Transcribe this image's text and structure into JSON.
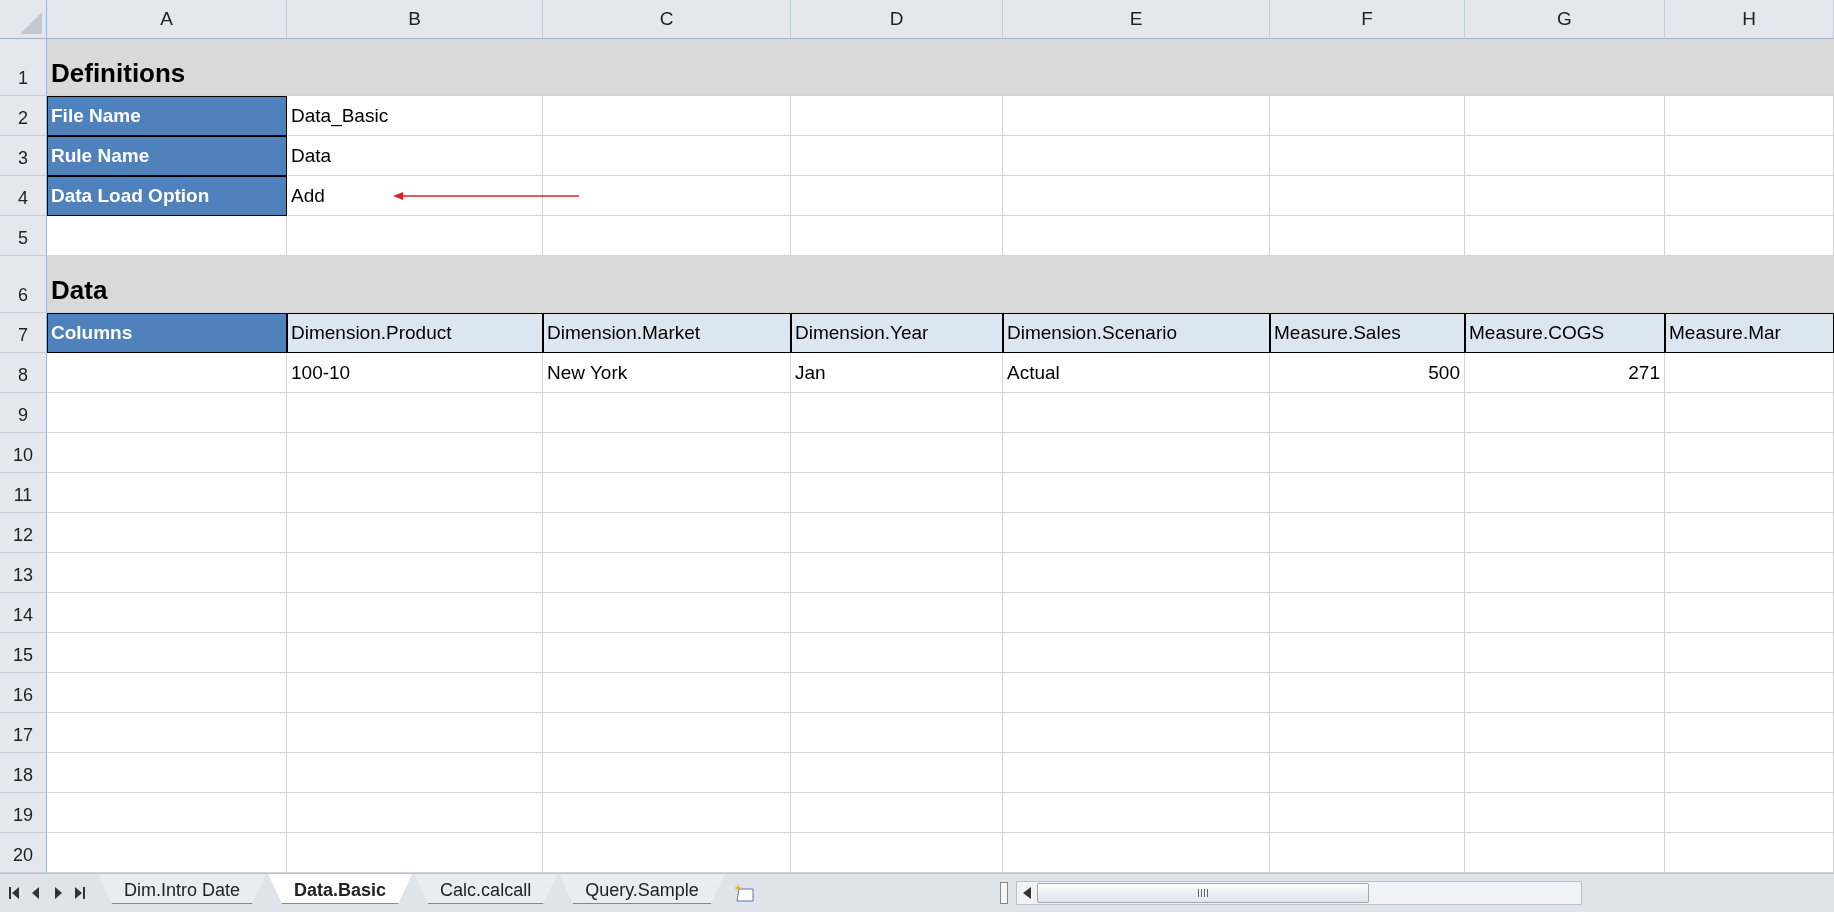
{
  "column_headers": [
    "A",
    "B",
    "C",
    "D",
    "E",
    "F",
    "G",
    "H"
  ],
  "rows": [
    {
      "number": "1",
      "kind": "title",
      "text": "Definitions"
    },
    {
      "number": "2",
      "kind": "field",
      "label": "File Name",
      "value": "Data_Basic",
      "arrow": false
    },
    {
      "number": "3",
      "kind": "field",
      "label": "Rule Name",
      "value": "Data",
      "arrow": false
    },
    {
      "number": "4",
      "kind": "field",
      "label": "Data Load Option",
      "value": "Add",
      "arrow": true
    },
    {
      "number": "5",
      "kind": "blank"
    },
    {
      "number": "6",
      "kind": "title",
      "text": "Data"
    },
    {
      "number": "7",
      "kind": "columns",
      "label": "Columns",
      "headers": [
        "Dimension.Product",
        "Dimension.Market",
        "Dimension.Year",
        "Dimension.Scenario",
        "Measure.Sales",
        "Measure.COGS",
        "Measure.Mar"
      ]
    },
    {
      "number": "8",
      "kind": "data",
      "cells": [
        {
          "text": "100-10",
          "kind": "text"
        },
        {
          "text": "New York",
          "kind": "text"
        },
        {
          "text": "Jan",
          "kind": "text"
        },
        {
          "text": "Actual",
          "kind": "text"
        },
        {
          "text": "500",
          "kind": "number"
        },
        {
          "text": "271",
          "kind": "number"
        }
      ]
    },
    {
      "number": "9",
      "kind": "blank"
    },
    {
      "number": "10",
      "kind": "blank"
    },
    {
      "number": "11",
      "kind": "blank"
    },
    {
      "number": "12",
      "kind": "blank"
    },
    {
      "number": "13",
      "kind": "blank"
    },
    {
      "number": "14",
      "kind": "blank"
    },
    {
      "number": "15",
      "kind": "blank"
    },
    {
      "number": "16",
      "kind": "blank"
    },
    {
      "number": "17",
      "kind": "blank"
    },
    {
      "number": "18",
      "kind": "blank"
    },
    {
      "number": "19",
      "kind": "blank"
    },
    {
      "number": "20",
      "kind": "blank"
    }
  ],
  "tabs": [
    {
      "label": "Dim.Intro Date",
      "selected": false
    },
    {
      "label": "Data.Basic",
      "selected": true
    },
    {
      "label": "Calc.calcall",
      "selected": false
    },
    {
      "label": "Query.Sample",
      "selected": false
    }
  ]
}
